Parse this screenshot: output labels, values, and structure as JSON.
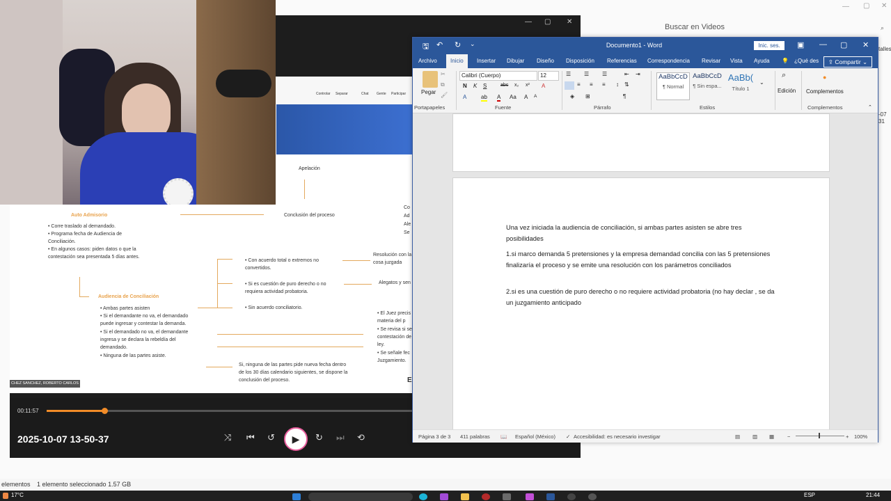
{
  "background_window": {
    "search_placeholder": "Buscar en Videos",
    "side_text": "talles",
    "side_text2": "-07",
    "side_text3": "31",
    "status": {
      "items": "elementos",
      "selection": "1 elemento seleccionado  1.57 GB"
    }
  },
  "player": {
    "time_elapsed": "00:11:57",
    "progress": 0.158,
    "title": "2025-10-07 13-50-37",
    "buttons": [
      "shuffle-icon",
      "previous-icon",
      "rewind-10-icon",
      "play-icon",
      "forward-30-icon",
      "next-icon",
      "repeat-off-icon"
    ],
    "slide": {
      "toolbar": [
        "Controlar",
        "Separar",
        "Chat",
        "Gente",
        "Participar"
      ],
      "apelacion": "Apelación",
      "conclusion": "Conclusión del proceso",
      "auto_admisorio": "Auto Admisorio",
      "auto_items": [
        "Corre traslado al demandado.",
        "Programa fecha de Audiencia de Conciliación.",
        "En algunos casos: piden datos o que la contestación sea presentada 5 días antes."
      ],
      "audiencia": "Audiencia de Conciliación",
      "audiencia_items": [
        "Ambas partes asisten",
        "Si el demandante no va, el demandado puede ingresar y contestar la demanda.",
        "Si el demandado no va, el demandante ingresa y se declara la rebeldía del demandado.",
        "Ninguna de las partes asiste."
      ],
      "branch1": "Con acuerdo total o extremos no convertidos.",
      "branch2": "Si es cuestión de puro derecho o no requiera actividad probatoria.",
      "branch3": "Sin acuerdo conciliatorio.",
      "res1": "Resolución con la cosa juzgada",
      "res2": "Alegatos y sen",
      "right_items": [
        "El Juez precis materia del p",
        "Se revisa si se contestación de ley.",
        "Se señale fec Juzgamiento."
      ],
      "bottom_text": "Si, ninguna de las partes pide nueva fecha dentro de los 30 días calendario siguientes, se dispone la conclusión del proceso.",
      "presenter": "CHEZ SANCHEZ, ROBERTO CARLOS",
      "corner_letters": "El",
      "bullets_right": [
        "Co",
        "Ad",
        "Ale",
        "Se"
      ]
    }
  },
  "word": {
    "title": "Documento1  -  Word",
    "signin": "Inic. ses.",
    "tabs": [
      "Archivo",
      "Inicio",
      "Insertar",
      "Dibujar",
      "Diseño",
      "Disposición",
      "Referencias",
      "Correspondencia",
      "Revisar",
      "Vista",
      "Ayuda"
    ],
    "tellme": "¿Qué des",
    "share": "Compartir",
    "ribbon": {
      "paste": "Pegar",
      "font_name": "Calibri (Cuerpo)",
      "font_size": "12",
      "groups": [
        "Portapapeles",
        "Fuente",
        "Párrafo",
        "Estilos",
        "Complementos"
      ],
      "styles": [
        {
          "preview": "AaBbCcD",
          "name": "¶ Normal"
        },
        {
          "preview": "AaBbCcD",
          "name": "¶ Sin espa..."
        },
        {
          "preview": "AaBb(",
          "name": "Título 1"
        }
      ],
      "edicion": "Edición",
      "complementos": "Complementos"
    },
    "document": {
      "paragraphs": [
        "Una vez iniciada la audiencia de conciliación, si ambas partes asisten se abre tres posibilidades",
        "1.si marco demanda 5 pretensiones y la empresa demandad concilia con las 5 pretensiones finalizaría el proceso y se emite una resolución con los parámetros conciliados",
        "2.si es una cuestión de puro derecho o no requiere actividad probatoria (no hay declar , se da un juzgamiento anticipado"
      ]
    },
    "status": {
      "page": "Página 3 de 3",
      "words": "411 palabras",
      "language": "Español (México)",
      "accessibility": "Accesibilidad: es necesario investigar",
      "zoom": "100%"
    }
  },
  "taskbar": {
    "temperature": "17°C",
    "language": "ESP",
    "time": "21:44"
  },
  "colors": {
    "word_blue": "#2b579a",
    "accent_orange": "#f28c28",
    "slide_orange": "#e3a85c"
  }
}
